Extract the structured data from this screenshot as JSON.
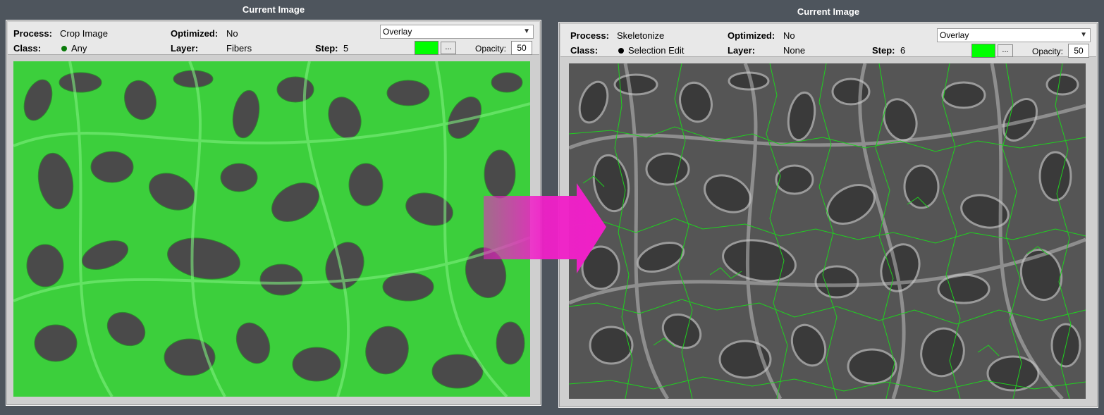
{
  "left_panel": {
    "title": "Current Image",
    "process_label": "Process:",
    "process_value": "Crop Image",
    "class_label": "Class:",
    "class_value": "Any",
    "class_dot_color": "#0a7a0a",
    "optimized_label": "Optimized:",
    "optimized_value": "No",
    "layer_label": "Layer:",
    "layer_value": "Fibers",
    "step_label": "Step:",
    "step_value": "5",
    "view_mode": "Overlay",
    "overlay_color": "#00ff00",
    "browse_label": "...",
    "opacity_label": "Opacity:",
    "opacity_value": "50"
  },
  "right_panel": {
    "title": "Current Image",
    "process_label": "Process:",
    "process_value": "Skeletonize",
    "class_label": "Class:",
    "class_value": "Selection Edit",
    "class_dot_color": "#000000",
    "optimized_label": "Optimized:",
    "optimized_value": "No",
    "layer_label": "Layer:",
    "layer_value": "None",
    "step_label": "Step:",
    "step_value": "6",
    "view_mode": "Overlay",
    "overlay_color": "#00ff00",
    "browse_label": "...",
    "opacity_label": "Opacity:",
    "opacity_value": "50"
  },
  "colors": {
    "background": "#4e555d",
    "fiber_overlay": "#3ccf3c",
    "skeleton_line": "#1fd11f",
    "arrow": "#f020c8"
  },
  "icons": {
    "dropdown": "chevron-down-icon",
    "transition": "right-arrow-icon"
  }
}
